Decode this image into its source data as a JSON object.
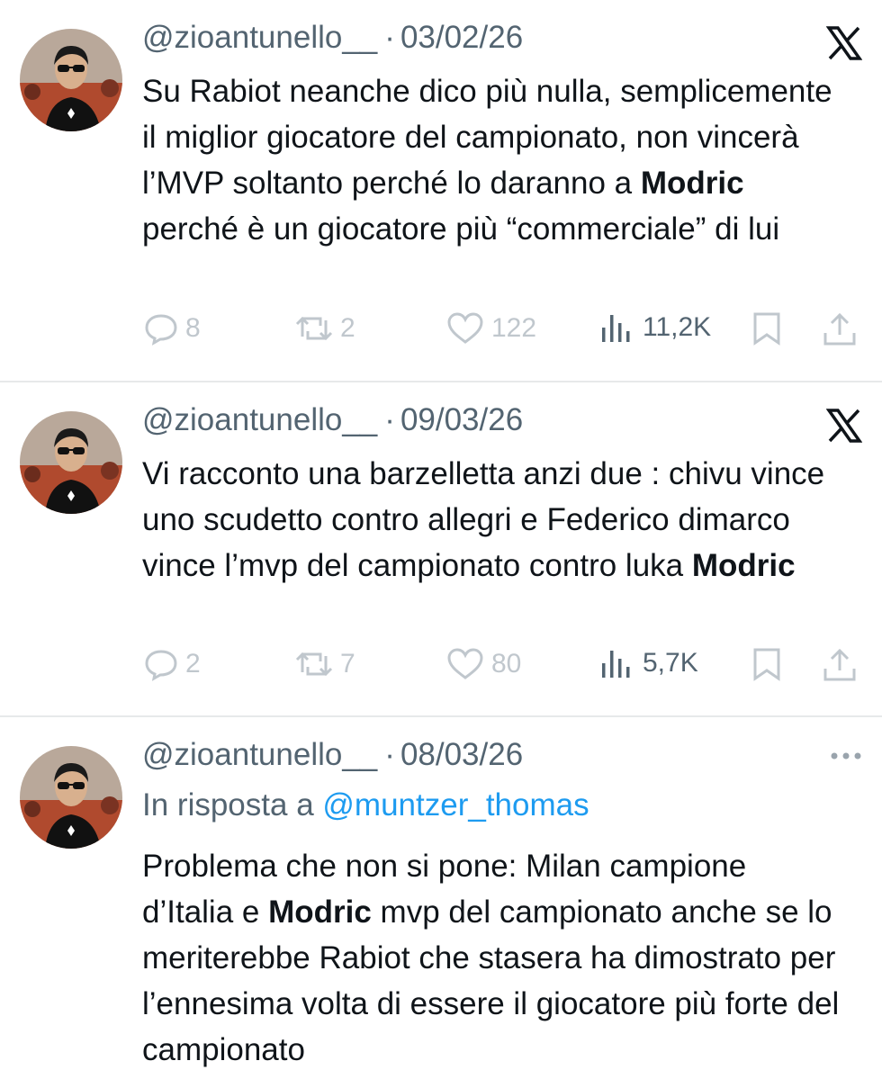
{
  "tweets": [
    {
      "handle": "@zioantunello__",
      "separator": "·",
      "date": "03/02/26",
      "corner_icon": "x-logo-icon",
      "body": [
        {
          "text": "Su Rabiot neanche dico più nulla, semplicemente il miglior giocatore del campionato, non vincerà l’MVP soltanto perché lo daranno a "
        },
        {
          "text": "Modric",
          "bold": true
        },
        {
          "text": " perché è un giocatore più “commerciale” di lui"
        }
      ],
      "stats": {
        "replies": "8",
        "retweets": "2",
        "likes": "122",
        "views": "11,2K"
      }
    },
    {
      "handle": "@zioantunello__",
      "separator": "·",
      "date": "09/03/26",
      "corner_icon": "x-logo-icon",
      "body": [
        {
          "text": "Vi racconto una barzelletta anzi due : chivu vince uno scudetto contro allegri e Federico dimarco vince l’mvp del campionato contro luka "
        },
        {
          "text": "Modric",
          "bold": true
        }
      ],
      "stats": {
        "replies": "2",
        "retweets": "7",
        "likes": "80",
        "views": "5,7K"
      }
    },
    {
      "handle": "@zioantunello__",
      "separator": "·",
      "date": "08/03/26",
      "corner_icon": "more-dots-icon",
      "reply_prefix": "In risposta a",
      "reply_mention": "@muntzer_thomas",
      "body": [
        {
          "text": "Problema che non si pone: Milan campione d’Italia e "
        },
        {
          "text": "Modric",
          "bold": true
        },
        {
          "text": " mvp del campionato anche se lo meriterebbe Rabiot che stasera ha dimostrato per l’ennesima volta di essere il giocatore più forte del campionato"
        }
      ]
    }
  ],
  "colors": {
    "text": "#0f1419",
    "secondary": "#536471",
    "faded": "#c0c7cd",
    "link": "#1d9bf0",
    "divider": "#e7e9ea"
  }
}
